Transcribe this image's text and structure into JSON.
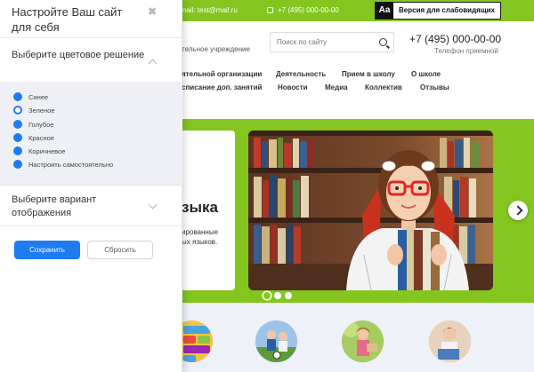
{
  "site": {
    "email": "-mail: test@mail.ru",
    "phone_small": "+7 (495) 000-00-00",
    "a11y_icon": "Aa",
    "a11y_label": "Версия для слабовидящих",
    "subtitle": "тельное учреждение",
    "search_placeholder": "Поиск по сайту",
    "phone_big": "+7 (495) 000-00-00",
    "phone_caption": "Телефон приемной",
    "nav": {
      "row1": [
        "ятельной организации",
        "Деятельность",
        "Прием в школу",
        "О школе"
      ],
      "row2": [
        "списание доп. занятий",
        "Новости",
        "Медиа",
        "Коллектив",
        "Отзывы"
      ]
    },
    "hero": {
      "heading": "зыка",
      "desc_line1": "ированные",
      "desc_line2": "ых языков."
    },
    "accent_color": "#84c51f"
  },
  "panel": {
    "title": "Настройте Ваш сайт для себя",
    "close_icon": "✖",
    "color_section": "Выберите цветовое решение",
    "color_options": [
      {
        "label": "Синее",
        "selected": false
      },
      {
        "label": "Зеленое",
        "selected": true
      },
      {
        "label": "Голубое",
        "selected": false
      },
      {
        "label": "Красное",
        "selected": false
      },
      {
        "label": "Коричневое",
        "selected": false
      },
      {
        "label": "Настроить самостоятельно",
        "selected": false
      }
    ],
    "display_section": "Выберите вариант отображения",
    "save_label": "Сохранить",
    "reset_label": "Сбросить",
    "primary_color": "#1e7bf2"
  }
}
